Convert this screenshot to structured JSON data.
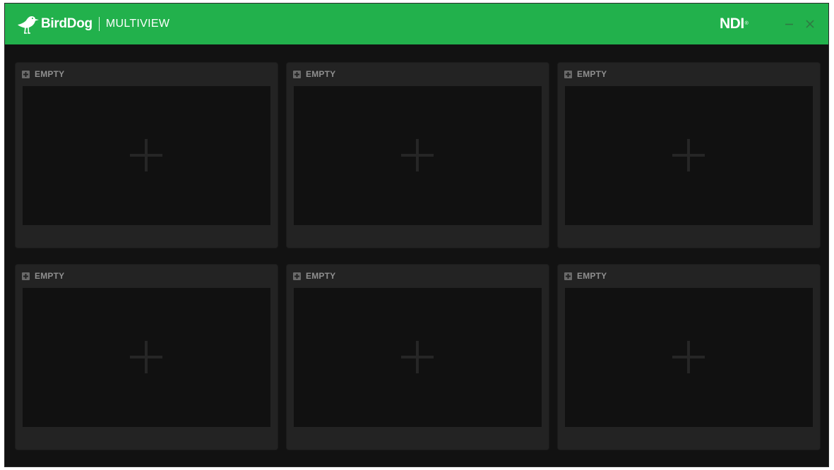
{
  "window": {
    "brand_name": "BirdDog",
    "product_name": "MULTIVIEW",
    "partner_logo": "NDI",
    "partner_logo_mark": "®",
    "controls": {
      "minimize_icon": "minimize-icon",
      "close_icon": "close-icon"
    },
    "accent_color": "#22b14c"
  },
  "panels": [
    {
      "label": "EMPTY",
      "icon": "add-icon"
    },
    {
      "label": "EMPTY",
      "icon": "add-icon"
    },
    {
      "label": "EMPTY",
      "icon": "add-icon"
    },
    {
      "label": "EMPTY",
      "icon": "add-icon"
    },
    {
      "label": "EMPTY",
      "icon": "add-icon"
    },
    {
      "label": "EMPTY",
      "icon": "add-icon"
    }
  ]
}
